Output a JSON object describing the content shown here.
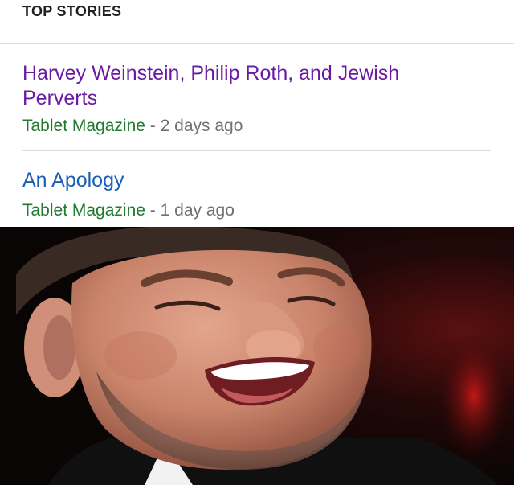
{
  "top_stories": {
    "header": "TOP STORIES",
    "items": [
      {
        "title": "Harvey Weinstein, Philip Roth, and Jewish Perverts",
        "source": "Tablet Magazine",
        "separator": "-",
        "age": "2 days ago",
        "title_color": "#6a1ba4"
      },
      {
        "title": "An Apology",
        "source": "Tablet Magazine",
        "separator": "-",
        "age": "1 day ago",
        "title_color": "#1a5fb4"
      }
    ]
  },
  "photo": {
    "subject": "close-up photo of a laughing bearded man",
    "icon": "portrait-photo"
  },
  "colors": {
    "source_green": "#1f7a2e",
    "meta_gray": "#707070",
    "divider": "#dcdcdc"
  }
}
